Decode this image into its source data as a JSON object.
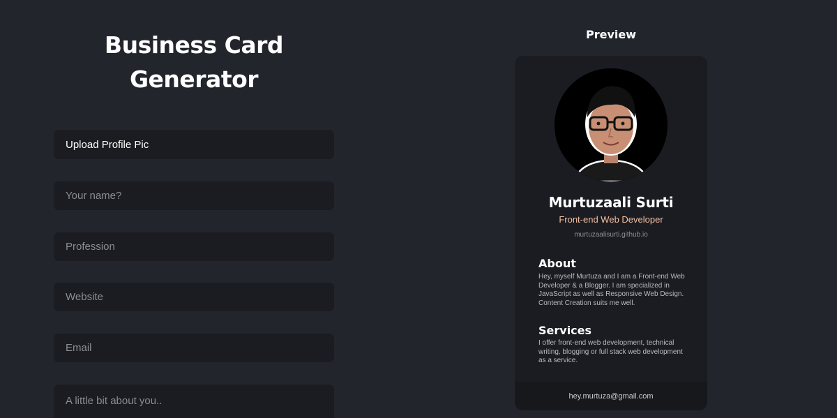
{
  "generator": {
    "title": "Business Card Generator",
    "upload_label": "Upload Profile Pic",
    "fields": {
      "name_placeholder": "Your name?",
      "profession_placeholder": "Profession",
      "website_placeholder": "Website",
      "email_placeholder": "Email",
      "about_placeholder": "A little bit about you.."
    }
  },
  "preview": {
    "title": "Preview",
    "card": {
      "name": "Murtuzaali Surti",
      "profession": "Front-end Web Developer",
      "website": "murtuzaalisurti.github.io",
      "about_heading": "About",
      "about_text": "Hey, myself Murtuza and I am a Front-end Web Developer & a Blogger. I am specialized in JavaScript as well as Responsive Web Design. Content Creation suits me well.",
      "services_heading": "Services",
      "services_text": "I offer front-end web development, technical writing, blogging or full stack web development as a service.",
      "email": "hey.murtuza@gmail.com",
      "avatar_icon": "profile-photo"
    }
  },
  "colors": {
    "background": "#22252c",
    "surface": "#1b1c21",
    "accent_profession": "#f3bfa3",
    "footer": "#17181c"
  }
}
